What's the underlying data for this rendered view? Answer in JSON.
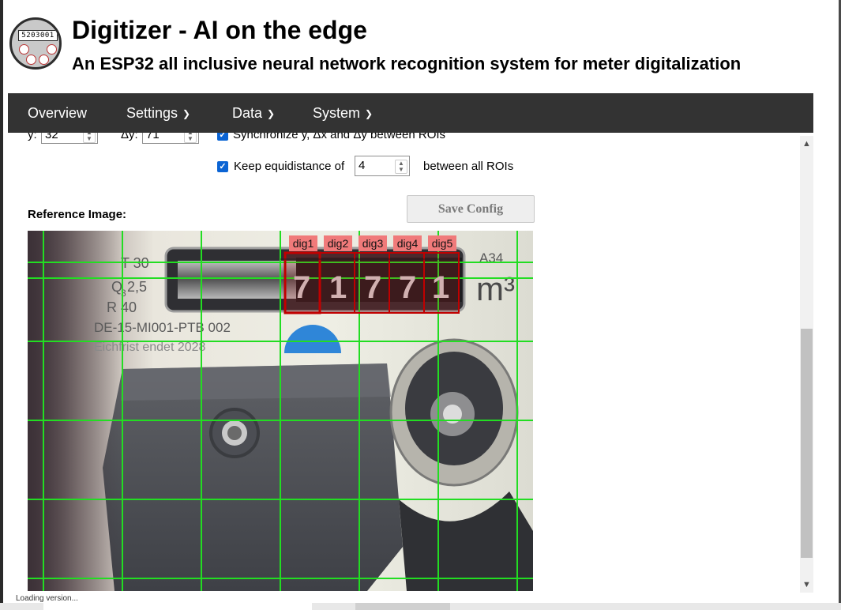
{
  "header": {
    "title": "Digitizer - AI on the edge",
    "subtitle": "An ESP32 all inclusive neural network recognition system for meter digitalization",
    "logo_counter": "5203001"
  },
  "nav": {
    "overview": "Overview",
    "settings": "Settings",
    "data": "Data",
    "system": "System"
  },
  "form": {
    "y_label": "y:",
    "y_value": "32",
    "dy_label": "Δy:",
    "dy_value": "71",
    "sync_label": "Synchronize y, Δx and Δy between ROIs",
    "equidistance_prefix": "Keep equidistance of",
    "equidistance_value": "4",
    "equidistance_suffix": "between all ROIs",
    "save_button": "Save Config",
    "reference_label": "Reference Image:"
  },
  "image": {
    "rois": [
      "dig1",
      "dig2",
      "dig3",
      "dig4",
      "dig5"
    ],
    "meter_text": {
      "t30": "T 30",
      "q": "Q",
      "q_sub": "3",
      "q_val": "2,5",
      "r40": "R 40",
      "serial": "DE-15-MI001-PTB 002",
      "eich": "Eichfrist endet 2028",
      "a34": "A34",
      "unit": "m³"
    },
    "colors": {
      "grid": "#22dd22",
      "roi_box": "#c00000",
      "roi_label_bg": "#f07a7a"
    }
  },
  "status": {
    "text": "Loading version..."
  }
}
